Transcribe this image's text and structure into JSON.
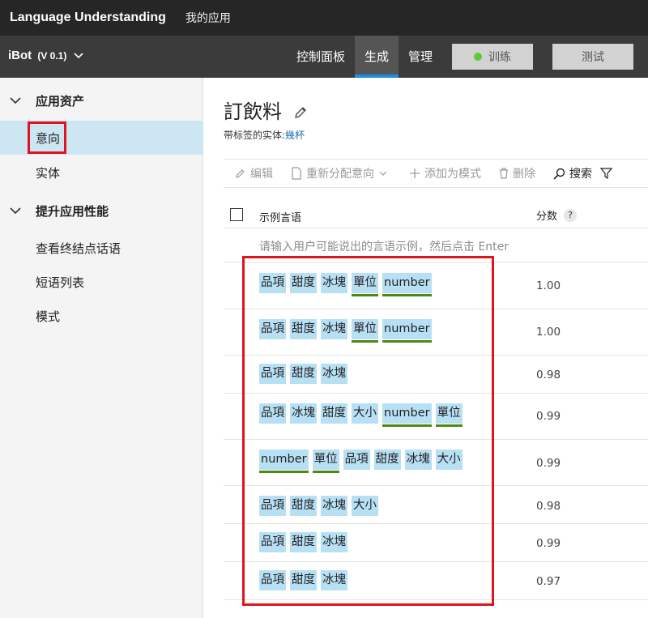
{
  "topbar": {
    "brand": "Language Understanding",
    "my_apps": "我的应用"
  },
  "appbar": {
    "app_name": "iBot",
    "version": "(V 0.1)",
    "tabs": [
      {
        "label": "控制面板",
        "active": false
      },
      {
        "label": "生成",
        "active": true
      },
      {
        "label": "管理",
        "active": false
      }
    ],
    "train_label": "训练",
    "train_status_color": "#5fc83a",
    "test_label": "测试"
  },
  "sidebar": {
    "section1": "应用资产",
    "items1": [
      "意向",
      "实体"
    ],
    "section2": "提升应用性能",
    "items2": [
      "查看终结点话语",
      "短语列表",
      "模式"
    ],
    "selected": "意向"
  },
  "main": {
    "title": "訂飲料",
    "subtitle_prefix": "带标签的实体:",
    "subtitle_link": "幾杯",
    "toolbar": {
      "edit": "编辑",
      "reassign": "重新分配意向",
      "add_pattern": "添加为模式",
      "delete": "删除",
      "search": "搜索"
    },
    "table": {
      "col_utterance": "示例言语",
      "col_score": "分数",
      "help": "?",
      "placeholder": "请输入用户可能说出的言语示例，然后点击 Enter"
    },
    "rows": [
      {
        "tokens": [
          "品項",
          "甜度",
          "冰塊",
          "單位",
          "number"
        ],
        "score": "1.00"
      },
      {
        "tokens": [
          "品項",
          "甜度",
          "冰塊",
          "單位",
          "number"
        ],
        "score": "1.00"
      },
      {
        "tokens": [
          "品項",
          "甜度",
          "冰塊"
        ],
        "score": "0.98"
      },
      {
        "tokens": [
          "品項",
          "冰塊",
          "甜度",
          "大小",
          "number",
          "單位"
        ],
        "score": "0.99"
      },
      {
        "tokens": [
          "number",
          "單位",
          "品項",
          "甜度",
          "冰塊",
          "大小"
        ],
        "score": "0.99"
      },
      {
        "tokens": [
          "品項",
          "甜度",
          "冰塊",
          "大小"
        ],
        "score": "0.98"
      },
      {
        "tokens": [
          "品項",
          "甜度",
          "冰塊"
        ],
        "score": "0.99"
      },
      {
        "tokens": [
          "品項",
          "甜度",
          "冰塊"
        ],
        "score": "0.97"
      }
    ]
  },
  "colors": {
    "accent": "#1e8fe0",
    "token_bg": "#b8e0f5",
    "underline": "#4f8a10",
    "highlight_box": "#e0141e",
    "sidebar_selected": "#cde6f4"
  }
}
